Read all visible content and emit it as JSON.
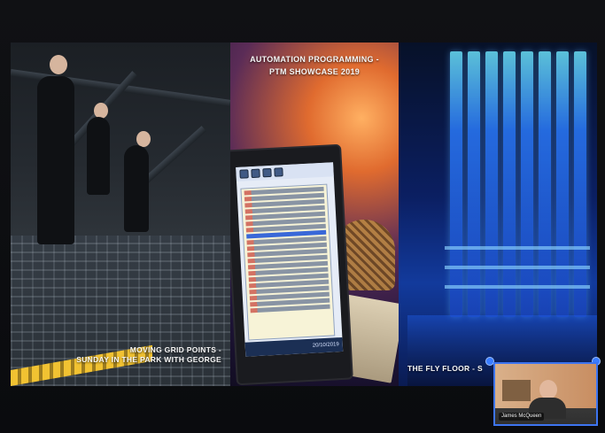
{
  "panels": {
    "left_caption_line1": "MOVING GRID POINTS -",
    "left_caption_line2": "SUNDAY IN THE PARK WITH GEORGE",
    "middle_caption_line1": "AUTOMATION PROGRAMMING -",
    "middle_caption_line2": "PTM SHOWCASE 2019",
    "right_caption": "THE FLY FLOOR - S"
  },
  "video_call": {
    "participant_name": "James McQueen"
  },
  "laptop": {
    "taskbar_date": "20/10/2019"
  },
  "colors": {
    "accent_blue": "#3d74f0",
    "caption_text": "#f7f7f7",
    "yellow_strip": "#f1c232"
  }
}
